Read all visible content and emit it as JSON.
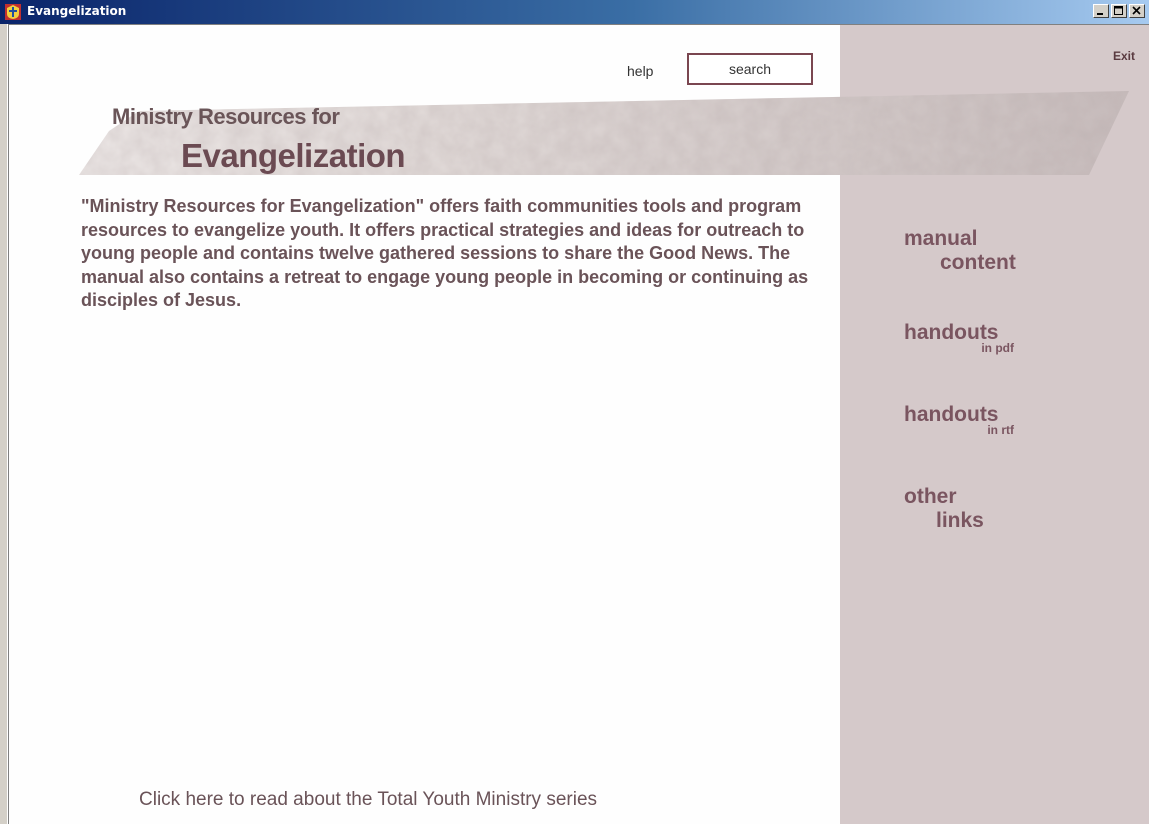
{
  "window": {
    "title": "Evangelization"
  },
  "header": {
    "help_label": "help",
    "search_label": "search",
    "exit_label": "Exit"
  },
  "banner": {
    "title_small": "Ministry Resources for",
    "title_big": "Evangelization"
  },
  "main": {
    "description": "\"Ministry Resources for Evangelization\" offers faith communities tools and program resources to evangelize youth. It offers practical strategies and ideas for outreach to young people and contains twelve gathered sessions to share the Good News. The manual also contains a retreat to engage young people in becoming or continuing as disciples of Jesus.",
    "footer_link": "Click here to read about the Total Youth Ministry series"
  },
  "sidebar": {
    "items": [
      {
        "line1": "manual",
        "line2": "content"
      },
      {
        "line1": "handouts",
        "sub": "in pdf"
      },
      {
        "line1": "handouts",
        "sub": "in rtf"
      },
      {
        "line1": "other",
        "line2": "links"
      }
    ]
  },
  "colors": {
    "sidebar_bg": "#d5c9ca",
    "accent": "#7a4650",
    "text": "#6a5358"
  }
}
